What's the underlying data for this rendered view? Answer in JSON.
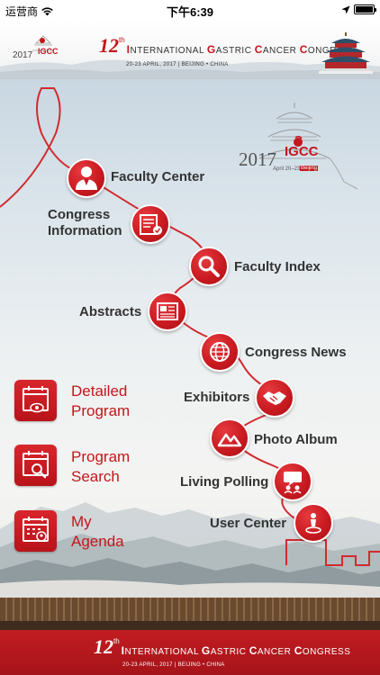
{
  "status_bar": {
    "carrier": "运营商",
    "time": "下午6:39"
  },
  "header": {
    "logo_year": "2017",
    "logo_name": "IGCC",
    "edition_number": "12",
    "edition_suffix": "th",
    "congress_name_parts": [
      "I",
      "NTERNATIONAL ",
      "G",
      "ASTRIC ",
      "C",
      "ANCER ",
      "C",
      "ONGRESS"
    ],
    "dates_location": "20-23 APRIL, 2017  |  BEIJING • CHINA"
  },
  "main_logo": {
    "year": "2017",
    "name": "IGCC",
    "dates": "April 20–23",
    "city": "Beijing"
  },
  "menu_nodes": [
    {
      "id": "faculty-center",
      "label": "Faculty Center",
      "icon": "person-suit-icon"
    },
    {
      "id": "congress-information",
      "label_line1": "Congress",
      "label_line2": "Information",
      "icon": "document-check-icon"
    },
    {
      "id": "faculty-index",
      "label": "Faculty Index",
      "icon": "magnifier-icon"
    },
    {
      "id": "abstracts",
      "label": "Abstracts",
      "icon": "newspaper-icon"
    },
    {
      "id": "congress-news",
      "label": "Congress News",
      "icon": "globe-icon"
    },
    {
      "id": "exhibitors",
      "label": "Exhibitors",
      "icon": "handshake-icon"
    },
    {
      "id": "photo-album",
      "label": "Photo Album",
      "icon": "mountain-photo-icon"
    },
    {
      "id": "living-polling",
      "label": "Living Polling",
      "icon": "chat-people-icon"
    },
    {
      "id": "user-center",
      "label": "User Center",
      "icon": "user-pin-icon"
    }
  ],
  "side_buttons": [
    {
      "id": "detailed-program",
      "line1": "Detailed",
      "line2": "Program",
      "icon": "calendar-eye-icon"
    },
    {
      "id": "program-search",
      "line1": "Program",
      "line2": "Search",
      "icon": "calendar-search-icon"
    },
    {
      "id": "my-agenda",
      "line1": "My",
      "line2": "Agenda",
      "icon": "calendar-user-icon"
    }
  ],
  "colors": {
    "brand_red": "#c4161c",
    "path_red": "#d12a2f",
    "label_text": "#333333"
  }
}
